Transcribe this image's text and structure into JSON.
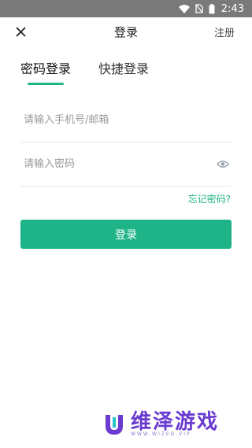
{
  "status_bar": {
    "time": "2:43",
    "icons": [
      "wifi-icon",
      "no-sim-icon",
      "battery-icon"
    ]
  },
  "header": {
    "title": "登录",
    "register_label": "注册",
    "close_icon": "close-icon"
  },
  "tabs": [
    {
      "label": "密码登录",
      "active": true
    },
    {
      "label": "快捷登录",
      "active": false
    }
  ],
  "form": {
    "account_placeholder": "请输入手机号/邮箱",
    "account_value": "",
    "password_placeholder": "请输入密码",
    "password_value": "",
    "show_password_icon": "eye-icon",
    "forgot_label": "忘记密码?",
    "login_label": "登录"
  },
  "watermark": {
    "title": "维泽游戏",
    "subtitle": "WWW.WIZED.VIP"
  },
  "colors": {
    "accent": "#1eb487",
    "status_bar": "#7a7a7a",
    "watermark": "#6a3bd1"
  }
}
